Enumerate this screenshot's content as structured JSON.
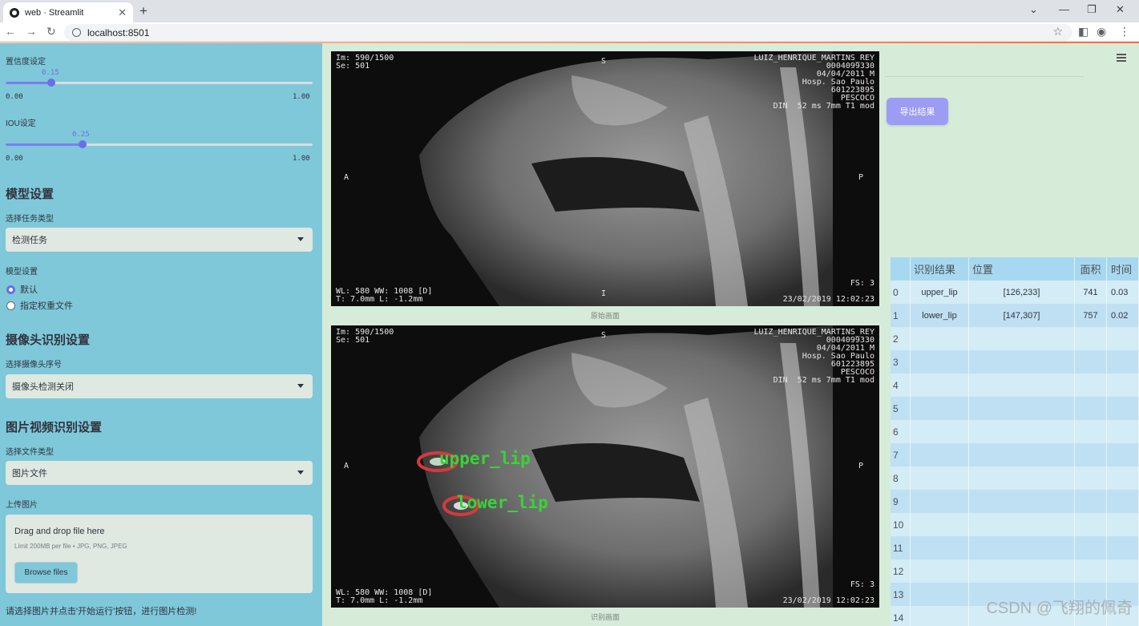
{
  "browser": {
    "tab_title": "web · Streamlit",
    "url": "localhost:8501"
  },
  "sidebar": {
    "confidence": {
      "label": "置信度设定",
      "value": 0.15,
      "value_text": "0.15",
      "min": "0.00",
      "max": "1.00"
    },
    "iou": {
      "label": "IOU设定",
      "value": 0.25,
      "value_text": "0.25",
      "min": "0.00",
      "max": "1.00"
    },
    "model_section": {
      "title": "模型设置",
      "task_label": "选择任务类型",
      "task_value": "检测任务",
      "model_label": "模型设置",
      "options": [
        "默认",
        "指定权重文件"
      ],
      "selected": 0
    },
    "camera_section": {
      "title": "摄像头识别设置",
      "camera_label": "选择摄像头序号",
      "camera_value": "摄像头检测关闭"
    },
    "file_section": {
      "title": "图片视频识别设置",
      "type_label": "选择文件类型",
      "type_value": "图片文件",
      "upload_label": "上传图片",
      "drop_text": "Drag and drop file here",
      "limit_text": "Limit 200MB per file • JPG, PNG, JPEG",
      "browse_label": "Browse files"
    },
    "hint": "请选择图片并点击'开始运行'按钮，进行图片检测!"
  },
  "main": {
    "original_caption": "原始画面",
    "result_caption": "识别画面",
    "export_label": "导出结果",
    "scan_overlay": {
      "top_left": "Im: 590/1500\nSe: 501",
      "top_right": "LUIZ_HENRIQUE_MARTINS_REY\n0004099330\n04/04/2011 M\nHosp. Sao Paulo\n601223895\nPESCOCO\nDIN  52 ms 7mm T1 mod",
      "bottom_left": "WL: 580 WW: 1008 [D]\nT: 7.0mm L: -1.2mm",
      "bottom_right": "FS: 3\n\n23/02/2019 12:02:23",
      "left": "A",
      "right": "P",
      "top": "S",
      "bottom": "I"
    },
    "detections": [
      {
        "label": "upper_lip"
      },
      {
        "label": "lower_lip"
      }
    ],
    "table": {
      "columns": [
        "识别结果",
        "位置",
        "面积",
        "时间"
      ],
      "rows": [
        {
          "index": "0",
          "result": "upper_lip",
          "position": "[126,233]",
          "area": "741",
          "time": "0.03"
        },
        {
          "index": "1",
          "result": "lower_lip",
          "position": "[147,307]",
          "area": "757",
          "time": "0.02"
        },
        {
          "index": "2",
          "result": "",
          "position": "",
          "area": "",
          "time": ""
        },
        {
          "index": "3",
          "result": "",
          "position": "",
          "area": "",
          "time": ""
        },
        {
          "index": "4",
          "result": "",
          "position": "",
          "area": "",
          "time": ""
        },
        {
          "index": "5",
          "result": "",
          "position": "",
          "area": "",
          "time": ""
        },
        {
          "index": "6",
          "result": "",
          "position": "",
          "area": "",
          "time": ""
        },
        {
          "index": "7",
          "result": "",
          "position": "",
          "area": "",
          "time": ""
        },
        {
          "index": "8",
          "result": "",
          "position": "",
          "area": "",
          "time": ""
        },
        {
          "index": "9",
          "result": "",
          "position": "",
          "area": "",
          "time": ""
        },
        {
          "index": "10",
          "result": "",
          "position": "",
          "area": "",
          "time": ""
        },
        {
          "index": "11",
          "result": "",
          "position": "",
          "area": "",
          "time": ""
        },
        {
          "index": "12",
          "result": "",
          "position": "",
          "area": "",
          "time": ""
        },
        {
          "index": "13",
          "result": "",
          "position": "",
          "area": "",
          "time": ""
        },
        {
          "index": "14",
          "result": "",
          "position": "",
          "area": "",
          "time": ""
        }
      ]
    }
  },
  "watermark": "CSDN @飞翔的佩奇",
  "colors": {
    "sidebar": "#7ec8d9",
    "main": "#d6ecd9",
    "accent": "#6b6ee8",
    "detection_box": "#d63a3a",
    "detection_label": "#39d339"
  }
}
